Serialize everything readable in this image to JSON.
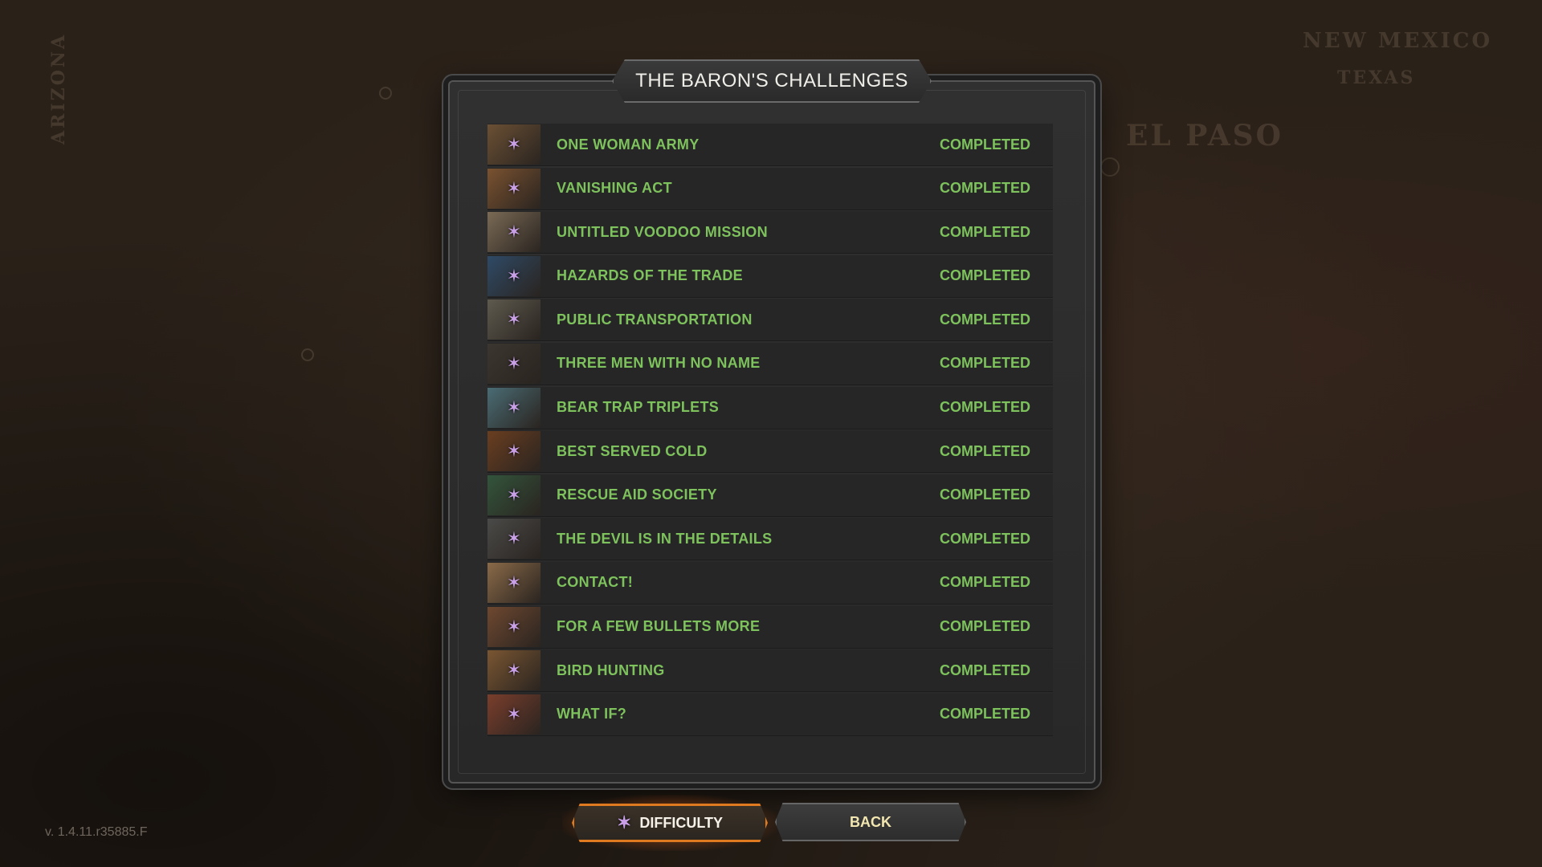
{
  "title": "THE BARON'S CHALLENGES",
  "challenges": [
    {
      "name": "ONE WOMAN ARMY",
      "status": "COMPLETED",
      "thumb_color": "#6b5034"
    },
    {
      "name": "VANISHING ACT",
      "status": "COMPLETED",
      "thumb_color": "#7a5230"
    },
    {
      "name": "UNTITLED VOODOO MISSION",
      "status": "COMPLETED",
      "thumb_color": "#7a6a55"
    },
    {
      "name": "HAZARDS OF THE TRADE",
      "status": "COMPLETED",
      "thumb_color": "#2f4a66"
    },
    {
      "name": "PUBLIC TRANSPORTATION",
      "status": "COMPLETED",
      "thumb_color": "#5e5a4e"
    },
    {
      "name": "THREE MEN WITH NO NAME",
      "status": "COMPLETED",
      "thumb_color": "#3c3630"
    },
    {
      "name": "BEAR TRAP TRIPLETS",
      "status": "COMPLETED",
      "thumb_color": "#4a6c74"
    },
    {
      "name": "BEST SERVED COLD",
      "status": "COMPLETED",
      "thumb_color": "#6a3e20"
    },
    {
      "name": "RESCUE AID SOCIETY",
      "status": "COMPLETED",
      "thumb_color": "#33553c"
    },
    {
      "name": "THE DEVIL IS IN THE DETAILS",
      "status": "COMPLETED",
      "thumb_color": "#4a4a48"
    },
    {
      "name": "CONTACT!",
      "status": "COMPLETED",
      "thumb_color": "#8a6a48"
    },
    {
      "name": "FOR A FEW BULLETS MORE",
      "status": "COMPLETED",
      "thumb_color": "#6e4830"
    },
    {
      "name": "BIRD HUNTING",
      "status": "COMPLETED",
      "thumb_color": "#7a5632"
    },
    {
      "name": "WHAT IF?",
      "status": "COMPLETED",
      "thumb_color": "#7a3e2c"
    }
  ],
  "buttons": {
    "difficulty": "DIFFICULTY",
    "back": "BACK"
  },
  "version": "v. 1.4.11.r35885.F",
  "map_labels": {
    "el_paso": "EL PASO",
    "new_mexico": "NEW MEXICO",
    "texas": "TEXAS",
    "arizona": "ARIZONA"
  },
  "icons": {
    "star": "✶"
  },
  "colors": {
    "completed_text": "#7dc25c",
    "star": "#c9a0e8",
    "difficulty_border": "#e07a20",
    "back_text": "#f2e6b0"
  }
}
